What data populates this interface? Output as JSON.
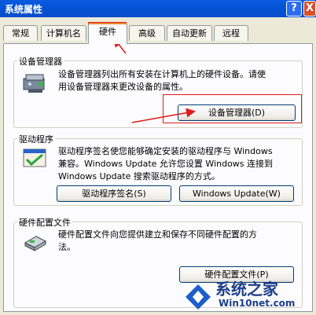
{
  "window": {
    "title": "系统属性",
    "help_label": "?",
    "close_label": "X"
  },
  "tabs": [
    {
      "label": "常规"
    },
    {
      "label": "计算机名"
    },
    {
      "label": "硬件",
      "active": true
    },
    {
      "label": "高级"
    },
    {
      "label": "自动更新"
    },
    {
      "label": "远程"
    }
  ],
  "device_manager": {
    "title": "设备管理器",
    "description_line1": "设备管理器列出所有安装在计算机上的硬件设备。请使",
    "description_line2": "用设备管理器来更改设备的属性。",
    "button_label": "设备管理器(D)"
  },
  "drivers": {
    "title": "驱动程序",
    "description_line1": "驱动程序签名使您能够确定安装的驱动程序与 Windows",
    "description_line2": "兼容。Windows Update 允许您设置 Windows 连接到",
    "description_line3": "Windows Update 搜索驱动程序的方式。",
    "signing_button_label": "驱动程序签名(S)",
    "update_button_label": "Windows Update(W)"
  },
  "hardware_profiles": {
    "title": "硬件配置文件",
    "description_line1": "硬件配置文件向您提供建立和保存不同硬件配置的方",
    "description_line2": "法。",
    "button_label": "硬件配置文件(P)"
  },
  "watermark": {
    "site_name": "系统之家",
    "url": "Win10net.com"
  },
  "colors": {
    "title_bar": "#0553d6",
    "annotation": "#e01b1b",
    "tab_highlight": "#e68b2c"
  }
}
